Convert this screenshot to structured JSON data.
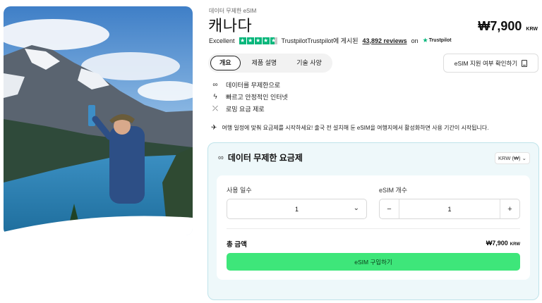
{
  "product": {
    "eyebrow": "데이터 무제한 eSIM",
    "title": "캐나다",
    "price": "₩7,900",
    "currency": "KRW"
  },
  "rating": {
    "label": "Excellent",
    "stars": 4.5,
    "posted_on": "Trustpilot에 게시된",
    "reviews": "43,892 reviews",
    "on": "on",
    "brand": "Trustpilot"
  },
  "tabs": [
    {
      "label": "개요",
      "active": true
    },
    {
      "label": "제품 설명",
      "active": false
    },
    {
      "label": "기술 사양",
      "active": false
    }
  ],
  "compat_button": "eSIM 지원 여부 확인하기",
  "features": [
    {
      "icon": "infinity-icon",
      "text": "데이터를 무제한으로"
    },
    {
      "icon": "bolt-icon",
      "text": "빠르고 안정적인 인터넷"
    },
    {
      "icon": "no-roaming-icon",
      "text": "로밍 요금 제로"
    }
  ],
  "note": "여행 일정에 맞춰 요금제를 시작하세요! 출국 전 설치해 둔 eSIM을 여행지에서 활성화하면 사용 기간이 시작됩니다.",
  "plan": {
    "title": "데이터 무제한 요금제",
    "currency_select": "KRW (₩)",
    "days_label": "사용 일수",
    "days_value": "1",
    "qty_label": "eSIM 개수",
    "qty_value": "1",
    "total_label": "총 금액",
    "total_amount": "₩7,900",
    "total_currency": "KRW",
    "buy_label": "eSIM 구입하기"
  },
  "colors": {
    "trustpilot_green": "#00b67a",
    "buy_green": "#3ee67a",
    "plan_bg": "#eef8fa"
  }
}
